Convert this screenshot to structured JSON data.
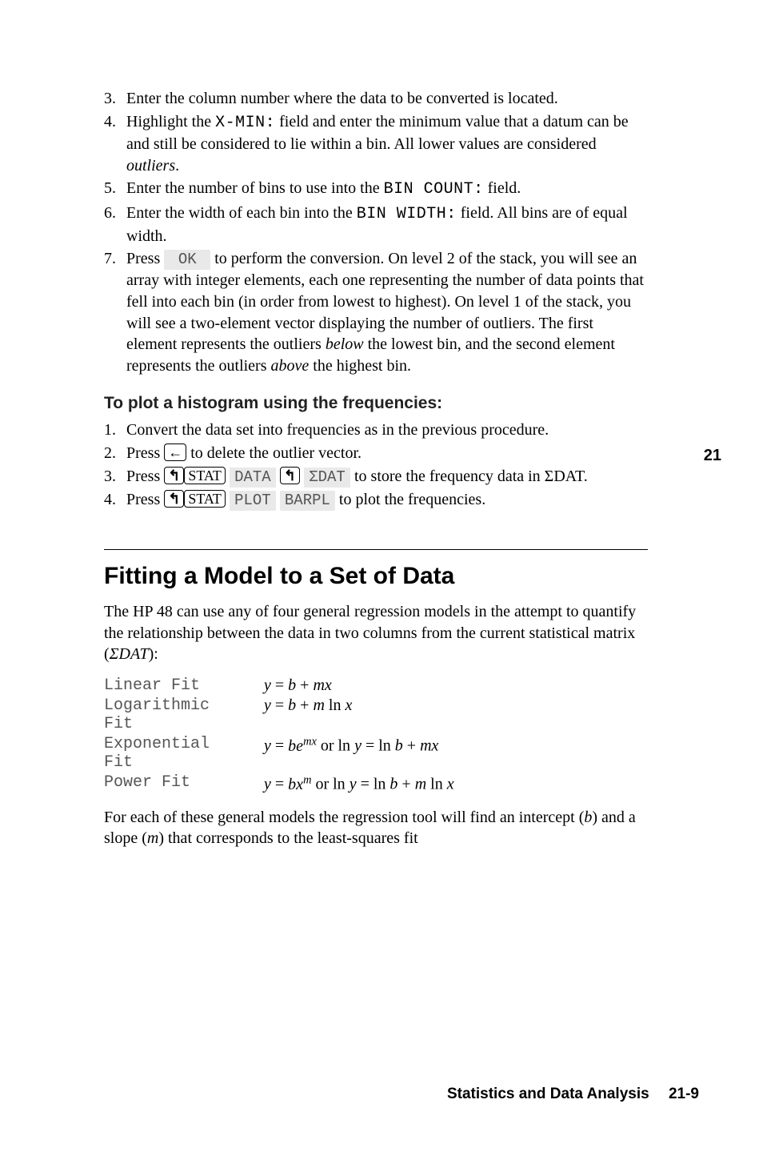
{
  "page_chapter": "21",
  "steps_top": [
    {
      "n": "3.",
      "text_parts": [
        "Enter the column number where the data to be converted is located."
      ]
    },
    {
      "n": "4.",
      "text_parts": [
        "Highlight the ",
        {
          "mono": "X-MIN:"
        },
        " field and enter the minimum value that a datum can be and still be considered to lie within a bin. All lower values are considered ",
        {
          "ital": "outliers"
        },
        "."
      ]
    },
    {
      "n": "5.",
      "text_parts": [
        "Enter the number of bins to use into the ",
        {
          "mono": "BIN COUNT:"
        },
        " field."
      ]
    },
    {
      "n": "6.",
      "text_parts": [
        "Enter the width of each bin into the ",
        {
          "mono": "BIN WIDTH:"
        },
        " field. All bins are of equal width."
      ]
    },
    {
      "n": "7.",
      "text_parts": [
        "Press ",
        {
          "soft": "  OK  "
        },
        " to perform the conversion. On level 2 of the stack, you will see an array with integer elements, each one representing the number of data points that fell into each bin (in order from lowest to highest). On level 1 of the stack, you will see a two-element vector displaying the number of outliers. The first element represents the outliers ",
        {
          "ital": "below"
        },
        " the lowest bin, and the second element represents the outliers ",
        {
          "ital": "above"
        },
        " the highest bin."
      ]
    }
  ],
  "subheading": "To plot a histogram using the frequencies:",
  "steps_hist": [
    {
      "n": "1.",
      "text_parts": [
        "Convert the data set into frequencies as in the previous procedure."
      ]
    },
    {
      "n": "2.",
      "text_parts": [
        "Press ",
        {
          "key": "←"
        },
        " to delete the outlier vector."
      ]
    },
    {
      "n": "3.",
      "text_parts": [
        "Press ",
        {
          "shiftkey": "↰"
        },
        {
          "key": "STAT"
        },
        " ",
        {
          "soft": " DATA "
        },
        " ",
        {
          "shiftkey": "↰"
        },
        " ",
        {
          "soft": " ΣDAT "
        },
        " to store the frequency data in ΣDAT."
      ]
    },
    {
      "n": "4.",
      "text_parts": [
        "Press ",
        {
          "shiftkey": "↰"
        },
        {
          "key": "STAT"
        },
        " ",
        {
          "soft": " PLOT "
        },
        " ",
        {
          "soft": " BARPL "
        },
        " to plot the frequencies."
      ]
    }
  ],
  "section_title": "Fitting a Model to a Set of Data",
  "intro_paragraph": "The HP 48 can use any of four general regression models in the attempt to quantify the relationship between the data in two columns from the current statistical matrix (ΣDAT):",
  "fits": [
    {
      "name": "Linear Fit",
      "formula_html": "<span class='italic'>y</span> = <span class='italic'>b</span> + <span class='italic'>mx</span>"
    },
    {
      "name": "Logarithmic Fit",
      "formula_html": "<span class='italic'>y</span> = <span class='italic'>b</span> + <span class='italic'>m</span> ln <span class='italic'>x</span>"
    },
    {
      "name": "Exponential Fit",
      "formula_html": "<span class='italic'>y</span> = <span class='italic'>be<span class='sup'>mx</span></span> or ln <span class='italic'>y</span> = ln <span class='italic'>b</span> + <span class='italic'>mx</span>"
    },
    {
      "name": "Power Fit",
      "formula_html": "<span class='italic'>y</span> = <span class='italic'>bx<span class='sup'>m</span></span> or ln <span class='italic'>y</span> = ln <span class='italic'>b</span> + <span class='italic'>m</span> ln <span class='italic'>x</span>"
    }
  ],
  "outro_paragraph": "For each of these general models the regression tool will find an intercept (b) and a slope (m) that corresponds to the least-squares fit",
  "footer": "Statistics and Data Analysis  21-9"
}
